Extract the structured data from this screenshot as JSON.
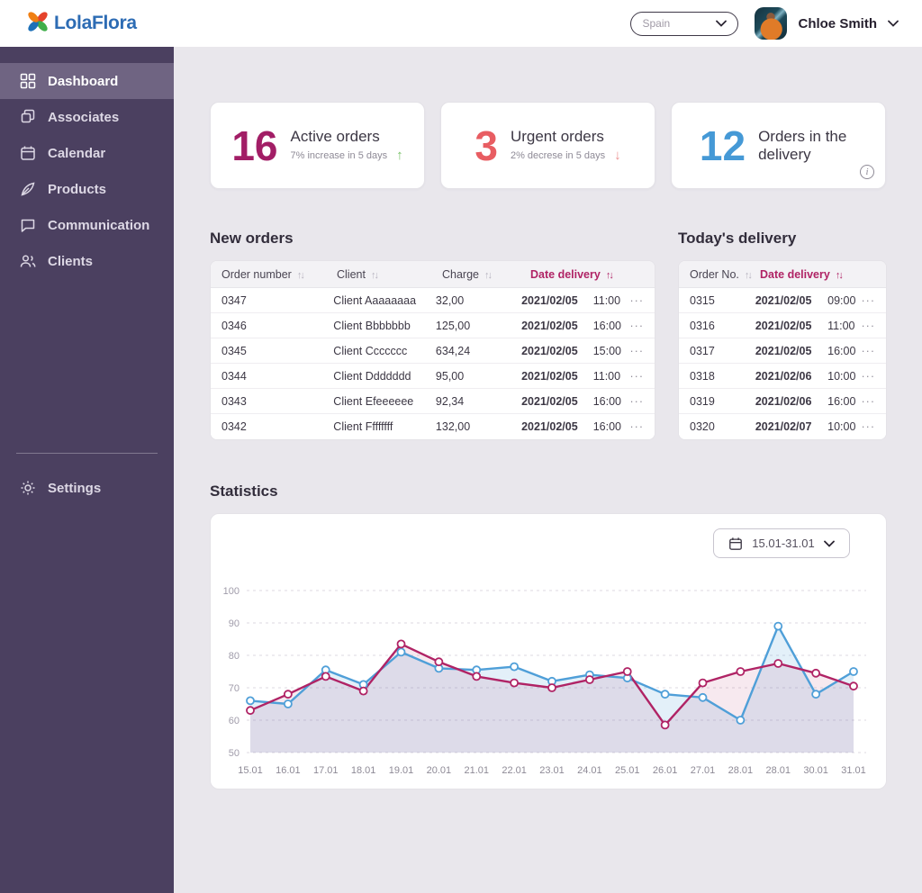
{
  "brand": {
    "name": "LolaFlora",
    "logo_colors": {
      "red": "#e5432b",
      "orange": "#f07f13",
      "green": "#3fae49",
      "blue": "#1d70b8"
    },
    "text_color": "#2d6cb4"
  },
  "topbar": {
    "country": "Spain",
    "user_name": "Chloe Smith"
  },
  "sidebar": {
    "items": [
      {
        "label": "Dashboard",
        "icon": "grid-icon",
        "active": true
      },
      {
        "label": "Associates",
        "icon": "copy-icon",
        "active": false
      },
      {
        "label": "Calendar",
        "icon": "calendar-icon",
        "active": false
      },
      {
        "label": "Products",
        "icon": "pen-icon",
        "active": false
      },
      {
        "label": "Communication",
        "icon": "chat-icon",
        "active": false
      },
      {
        "label": "Clients",
        "icon": "people-icon",
        "active": false
      }
    ],
    "settings_label": "Settings",
    "bg": "#4b4060",
    "active_bg": "#6f6482"
  },
  "cards": [
    {
      "value": "16",
      "color": "#a21e66",
      "label": "Active orders",
      "sub": "7% increase in 5 days",
      "trend": "up",
      "trend_color": "#76c066"
    },
    {
      "value": "3",
      "color": "#e85d62",
      "label": "Urgent orders",
      "sub": "2% decrese in 5 days",
      "trend": "down",
      "trend_color": "#ec9191"
    },
    {
      "value": "12",
      "color": "#4599d6",
      "label": "Orders in the delivery",
      "sub": "",
      "trend": "info",
      "trend_color": "#8e8a96"
    }
  ],
  "new_orders": {
    "title": "New orders",
    "columns": [
      "Order number",
      "Client",
      "Charge",
      "Date delivery"
    ],
    "sorted_column": "Date delivery",
    "rows": [
      {
        "order": "0347",
        "client": "Client Aaaaaaaa",
        "charge": "32,00",
        "date": "2021/02/05",
        "time": "11:00"
      },
      {
        "order": "0346",
        "client": "Client Bbbbbbb",
        "charge": "125,00",
        "date": "2021/02/05",
        "time": "16:00"
      },
      {
        "order": "0345",
        "client": "Client Ccccccc",
        "charge": "634,24",
        "date": "2021/02/05",
        "time": "15:00"
      },
      {
        "order": "0344",
        "client": "Client Ddddddd",
        "charge": "95,00",
        "date": "2021/02/05",
        "time": "11:00"
      },
      {
        "order": "0343",
        "client": "Client Efeeeeee",
        "charge": "92,34",
        "date": "2021/02/05",
        "time": "16:00"
      },
      {
        "order": "0342",
        "client": "Client Ffffffff",
        "charge": "132,00",
        "date": "2021/02/05",
        "time": "16:00"
      }
    ]
  },
  "todays_delivery": {
    "title": "Today's delivery",
    "columns": [
      "Order No.",
      "Date delivery"
    ],
    "sorted_column": "Date delivery",
    "rows": [
      {
        "order": "0315",
        "date": "2021/02/05",
        "time": "09:00"
      },
      {
        "order": "0316",
        "date": "2021/02/05",
        "time": "11:00"
      },
      {
        "order": "0317",
        "date": "2021/02/05",
        "time": "16:00"
      },
      {
        "order": "0318",
        "date": "2021/02/06",
        "time": "10:00"
      },
      {
        "order": "0319",
        "date": "2021/02/06",
        "time": "16:00"
      },
      {
        "order": "0320",
        "date": "2021/02/07",
        "time": "10:00"
      }
    ]
  },
  "statistics": {
    "title": "Statistics",
    "range_label": "15.01-31.01"
  },
  "chart_data": {
    "type": "line",
    "x": [
      "15.01",
      "16.01",
      "17.01",
      "18.01",
      "19.01",
      "20.01",
      "21.01",
      "22.01",
      "23.01",
      "24.01",
      "25.01",
      "26.01",
      "27.01",
      "28.01",
      "28.01",
      "30.01",
      "31.01"
    ],
    "series": [
      {
        "name": "series-blue",
        "color": "#4f9fd8",
        "fill_opacity": 0.16,
        "values": [
          66,
          65,
          75.5,
          71,
          81,
          76,
          75.5,
          76.5,
          72,
          74,
          73,
          68,
          67,
          60,
          89,
          68,
          75
        ]
      },
      {
        "name": "series-magenta",
        "color": "#b02365",
        "fill_opacity": 0.1,
        "values": [
          63,
          68,
          73.5,
          69,
          83.5,
          78,
          73.5,
          71.5,
          70,
          72.5,
          75,
          58.5,
          71.5,
          75,
          77.5,
          74.5,
          70.5
        ]
      }
    ],
    "ylim": [
      50,
      100
    ],
    "yticks": [
      50,
      60,
      70,
      80,
      90,
      100
    ],
    "grid": "dashed-horizontal",
    "legend": "none",
    "marker": "open-circle"
  }
}
